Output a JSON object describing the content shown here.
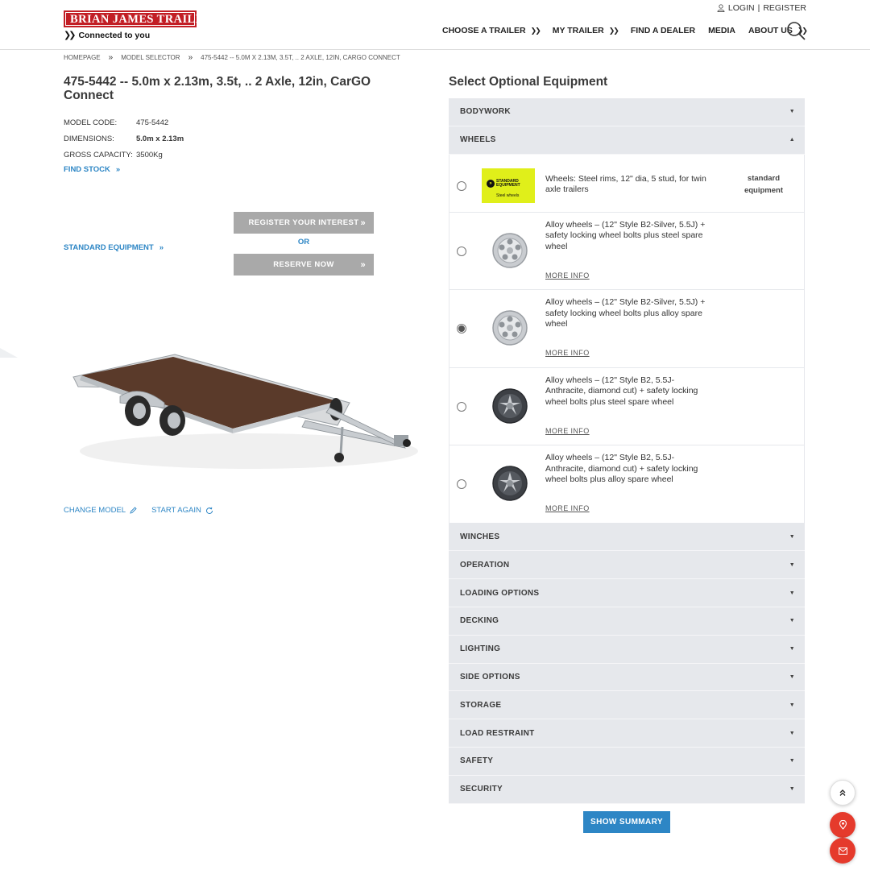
{
  "header": {
    "logo_text": "BRIAN JAMES TRAILERS",
    "tagline": "Connected to you",
    "login": "LOGIN",
    "divider": "|",
    "register": "REGISTER",
    "nav": [
      {
        "label": "CHOOSE A TRAILER",
        "dropdown": true
      },
      {
        "label": "MY TRAILER",
        "dropdown": true
      },
      {
        "label": "FIND A DEALER",
        "dropdown": false
      },
      {
        "label": "MEDIA",
        "dropdown": false
      },
      {
        "label": "ABOUT US",
        "dropdown": true
      }
    ],
    "colors": {
      "brand_red": "#c21e25",
      "link_blue": "#2d86c5"
    }
  },
  "breadcrumb": {
    "items": [
      "HOMEPAGE",
      "MODEL SELECTOR",
      "475-5442 -- 5.0M X 2.13M, 3.5T, .. 2 AXLE, 12IN, CARGO CONNECT"
    ],
    "separator": "»"
  },
  "model": {
    "title": "475-5442 -- 5.0m x 2.13m, 3.5t, .. 2 Axle, 12in, CarGO Connect",
    "specs": [
      {
        "label": "MODEL CODE:",
        "value": "475-5442",
        "bold": false
      },
      {
        "label": "DIMENSIONS:",
        "value": "5.0m x 2.13m",
        "bold": true
      },
      {
        "label": "GROSS CAPACITY:",
        "value": "3500Kg",
        "bold": false
      }
    ],
    "find_stock": "FIND STOCK",
    "standard_equipment": "STANDARD EQUIPMENT",
    "register_interest": "REGISTER YOUR INTEREST",
    "or": "OR",
    "reserve_now": "RESERVE NOW",
    "change_model": "CHANGE MODEL",
    "start_again": "START AGAIN"
  },
  "options": {
    "title": "Select Optional Equipment",
    "sections_before": [
      {
        "label": "BODYWORK",
        "expanded": false
      },
      {
        "label": "WHEELS",
        "expanded": true
      }
    ],
    "wheels": [
      {
        "desc": "Wheels: Steel rims, 12\" dia, 5 stud, for twin axle trailers",
        "standard": true,
        "std_line1": "standard",
        "std_line2": "equipment",
        "thumb_line1": "STANDARD",
        "thumb_line2": "EQUIPMENT",
        "thumb_line3": "Steel wheels",
        "selected": false
      },
      {
        "desc": "Alloy wheels – (12\" Style B2-Silver, 5.5J) + safety locking wheel bolts plus steel spare wheel",
        "more": "MORE INFO",
        "style": "silver",
        "selected": false
      },
      {
        "desc": "Alloy wheels – (12\" Style B2-Silver, 5.5J) + safety locking wheel bolts plus alloy spare wheel",
        "more": "MORE INFO",
        "style": "silver",
        "selected": true
      },
      {
        "desc": "Alloy wheels – (12\" Style B2, 5.5J-Anthracite, diamond cut) + safety locking wheel bolts plus steel spare wheel",
        "more": "MORE INFO",
        "style": "anthracite",
        "selected": false
      },
      {
        "desc": "Alloy wheels – (12\" Style B2, 5.5J-Anthracite, diamond cut) + safety locking wheel bolts plus alloy spare wheel",
        "more": "MORE INFO",
        "style": "anthracite",
        "selected": false
      }
    ],
    "sections_after": [
      "WINCHES",
      "OPERATION",
      "LOADING OPTIONS",
      "DECKING",
      "LIGHTING",
      "SIDE OPTIONS",
      "STORAGE",
      "LOAD RESTRAINT",
      "SAFETY",
      "SECURITY"
    ],
    "show_summary": "SHOW SUMMARY"
  },
  "fabs": {
    "top_icon": "double-chevron-up-icon",
    "location_icon": "location-pin-icon",
    "mail_icon": "mail-icon"
  }
}
